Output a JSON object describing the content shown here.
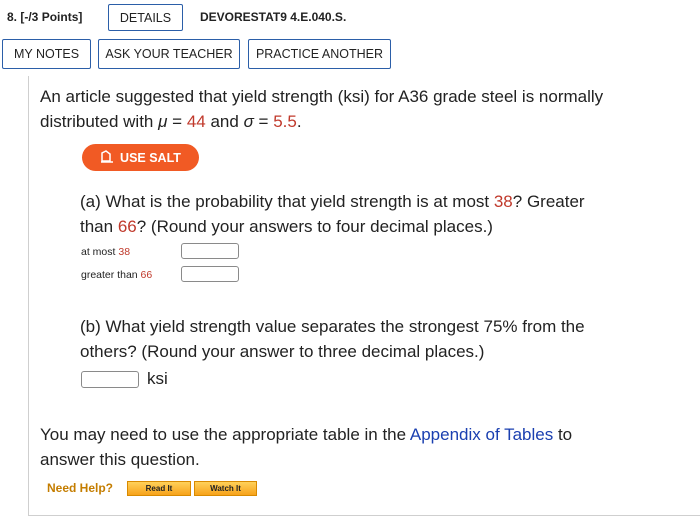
{
  "header": {
    "number": "8.",
    "points": "[-/3 Points]",
    "details_label": "DETAILS",
    "problem_code": "DEVORESTAT9 4.E.040.S."
  },
  "toolbar": {
    "my_notes": "MY NOTES",
    "ask_teacher": "ASK YOUR TEACHER",
    "practice_another": "PRACTICE ANOTHER"
  },
  "intro": {
    "line1": "An article suggested that yield strength (ksi) for A36 grade steel is normally",
    "line2_pre": "distributed with ",
    "mu_symbol": "μ",
    "eq1": " = ",
    "mu_value": "44",
    "and": " and ",
    "sigma_symbol": "σ",
    "eq2": " = ",
    "sigma_value": "5.5",
    "period": "."
  },
  "salt_button": "USE SALT",
  "part_a": {
    "q1": "(a) What is the probability that yield strength is at most ",
    "v1": "38",
    "q2": "? Greater",
    "line2_pre": "than ",
    "v2": "66",
    "line2_post": "? (Round your answers to four decimal places.)",
    "label1_pre": "at most ",
    "label1_val": "38",
    "label2_pre": "greater than ",
    "label2_val": "66"
  },
  "part_b": {
    "line1": "(b) What yield strength value separates the strongest 75% from the",
    "line2": "others? (Round your answer to three decimal places.)",
    "unit": "ksi"
  },
  "footer": {
    "line1_pre": "You may need to use the appropriate table in the ",
    "link": "Appendix of Tables",
    "line1_post": " to",
    "line2": "answer this question.",
    "need_help": "Need Help?",
    "read_it": "Read It",
    "watch_it": "Watch It"
  },
  "colors": {
    "accent": "#2b5ea8",
    "salt": "#f15a24",
    "value_red": "#c0392b",
    "link": "#1a3fb0"
  }
}
